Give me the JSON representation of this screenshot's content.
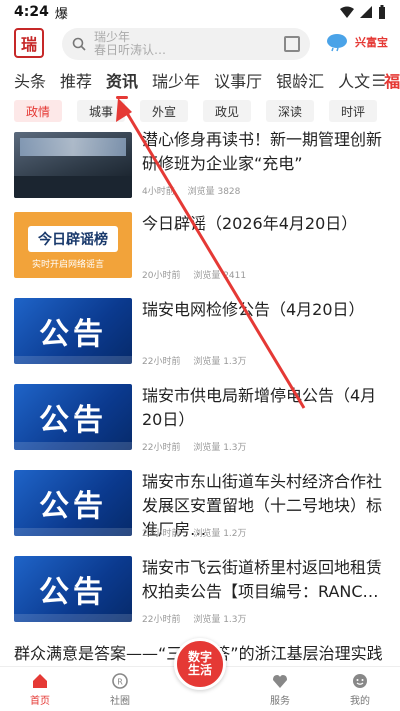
{
  "status": {
    "time": "4:24",
    "flag": "爆"
  },
  "header": {
    "logo_text": "瑞",
    "search_line1": "瑞少年",
    "search_line2": "春日听涛认…",
    "brand": "兴富宝"
  },
  "tabs": [
    "头条",
    "推荐",
    "资讯",
    "瑞少年",
    "议事厅",
    "银龄汇",
    "人文",
    "福利"
  ],
  "chips": [
    "政情",
    "城事",
    "外宣",
    "政见",
    "深读",
    "时评"
  ],
  "articles": [
    {
      "title": "潜心修身再读书！新一期管理创新研修班为企业家“充电”",
      "time": "4小时前",
      "views": "浏览量 3828"
    },
    {
      "title": "今日辟谣（2026年4月20日）",
      "time": "20小时前",
      "views": "浏览量 2411",
      "thumb_main": "今日辟谣榜",
      "thumb_sub": "实时开启网络谣言"
    },
    {
      "title": "瑞安电网检修公告（4月20日）",
      "time": "22小时前",
      "views": "浏览量 1.3万",
      "thumb_word": "公告"
    },
    {
      "title": "瑞安市供电局新增停电公告（4月20日）",
      "time": "22小时前",
      "views": "浏览量 1.3万",
      "thumb_word": "公告"
    },
    {
      "title": "瑞安市东山街道车头村经济合作社发展区安置留地（十二号地块）标准厂房…",
      "time": "22小时前",
      "views": "浏览量 1.2万",
      "thumb_word": "公告"
    },
    {
      "title": "瑞安市飞云街道桥里村返回地租赁权拍卖公告【项目编号：RANC…",
      "time": "22小时前",
      "views": "浏览量 1.3万",
      "thumb_word": "公告"
    }
  ],
  "bottom_headline": "群众满意是答案——“三考一答”的浙江基层治理实践",
  "bottom_nav": [
    "首页",
    "社圈",
    "",
    "服务",
    "我的"
  ],
  "center_button": "数字生活",
  "colors": {
    "accent": "#e53935",
    "annotation": "#e53935"
  }
}
